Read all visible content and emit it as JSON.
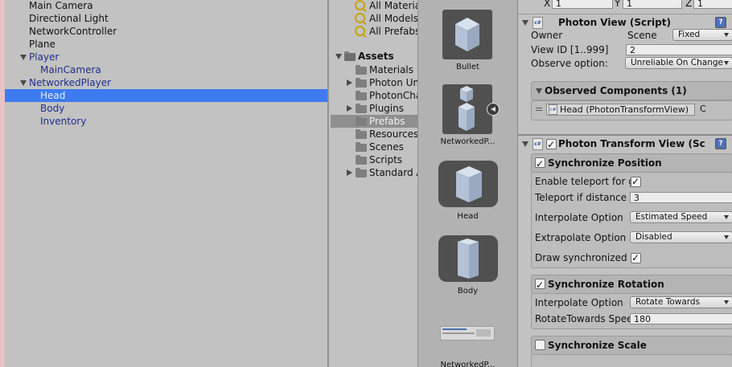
{
  "hierarchy": {
    "items": [
      {
        "label": "Main Camera"
      },
      {
        "label": "Directional Light"
      },
      {
        "label": "NetworkController"
      },
      {
        "label": "Plane"
      },
      {
        "label": "Player"
      },
      {
        "label": "MainCamera"
      },
      {
        "label": "NetworkedPlayer"
      },
      {
        "label": "Head"
      },
      {
        "label": "Body"
      },
      {
        "label": "Inventory"
      }
    ]
  },
  "project": {
    "favorites": [
      "All Materia",
      "All Models",
      "All Prefabs"
    ],
    "assets_root": "Assets",
    "folders": [
      "Materials",
      "Photon Uni",
      "PhotonCha",
      "Plugins",
      "Prefabs",
      "Resources",
      "Scenes",
      "Scripts",
      "Standard A"
    ]
  },
  "asset_grid": {
    "items": [
      {
        "label": "Bullet",
        "icon": "cube-prefab-icon"
      },
      {
        "label": "NetworkedP...",
        "icon": "multi-cube-prefab-icon"
      },
      {
        "label": "Head",
        "icon": "cube-prefab-icon"
      },
      {
        "label": "Body",
        "icon": "box-prefab-icon"
      },
      {
        "label": "NetworkedP...",
        "icon": "prefab-thumbnail-icon"
      }
    ]
  },
  "inspector": {
    "transform_row": {
      "x_label": "X",
      "x_value": "1",
      "y_label": "Y",
      "y_value": "1",
      "z_label": "Z",
      "z_value": "1"
    },
    "photon_view": {
      "title": "Photon View (Script)",
      "owner_label": "Owner",
      "owner_value": "Scene",
      "owner_dropdown": "Fixed",
      "view_id_label": "View ID [1..999]",
      "view_id_value": "2",
      "observe_label": "Observe option:",
      "observe_value": "Unreliable On Change",
      "observed_header": "Observed Components (1)",
      "observed_item": "Head (PhotonTransformView)",
      "observed_suffix": "C"
    },
    "transform_view": {
      "title": "Photon Transform View (Sc",
      "sync_position": "Synchronize Position",
      "teleport_enable_label": "Enable teleport for g",
      "teleport_distance_label": "Teleport if distance g",
      "teleport_distance_value": "3",
      "interp_label": "Interpolate Option",
      "interp_value": "Estimated Speed",
      "extrap_label": "Extrapolate Option",
      "extrap_value": "Disabled",
      "draw_label": "Draw synchronized p",
      "sync_rotation": "Synchronize Rotation",
      "rot_interp_label": "Interpolate Option",
      "rot_interp_value": "Rotate Towards",
      "rot_speed_label": "RotateTowards Spee",
      "rot_speed_value": "180",
      "sync_scale": "Synchronize Scale"
    },
    "help_glyph": "?",
    "script_glyph": "c#"
  }
}
